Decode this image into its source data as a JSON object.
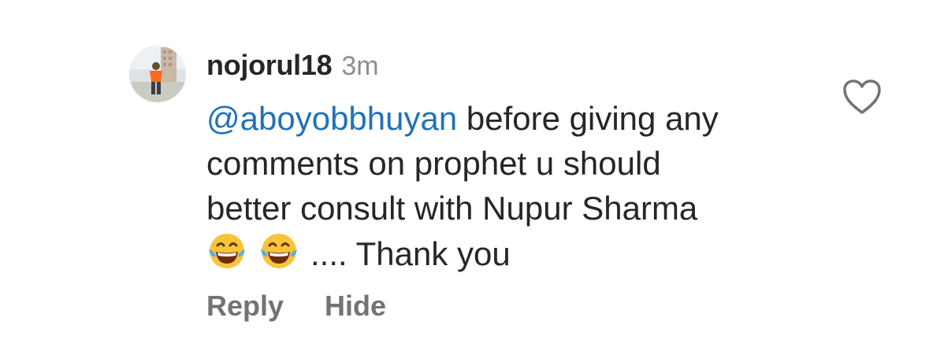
{
  "comment": {
    "username": "nojorul18",
    "time": "3m",
    "mention": "@aboyobbhuyan",
    "line1_rest": " before giving any",
    "line2": "comments on prophet u should",
    "line3": "better consult with Nupur Sharma",
    "line4_text": ".... Thank you",
    "emojis": [
      "laughing-tears-emoji",
      "laughing-tears-emoji"
    ]
  },
  "actions": {
    "reply": "Reply",
    "hide": "Hide"
  },
  "icons": {
    "like": "heart-outline-icon"
  },
  "colors": {
    "mention": "#1f72b8",
    "text": "#262626",
    "muted": "#8e8e8e",
    "action": "#737373"
  }
}
